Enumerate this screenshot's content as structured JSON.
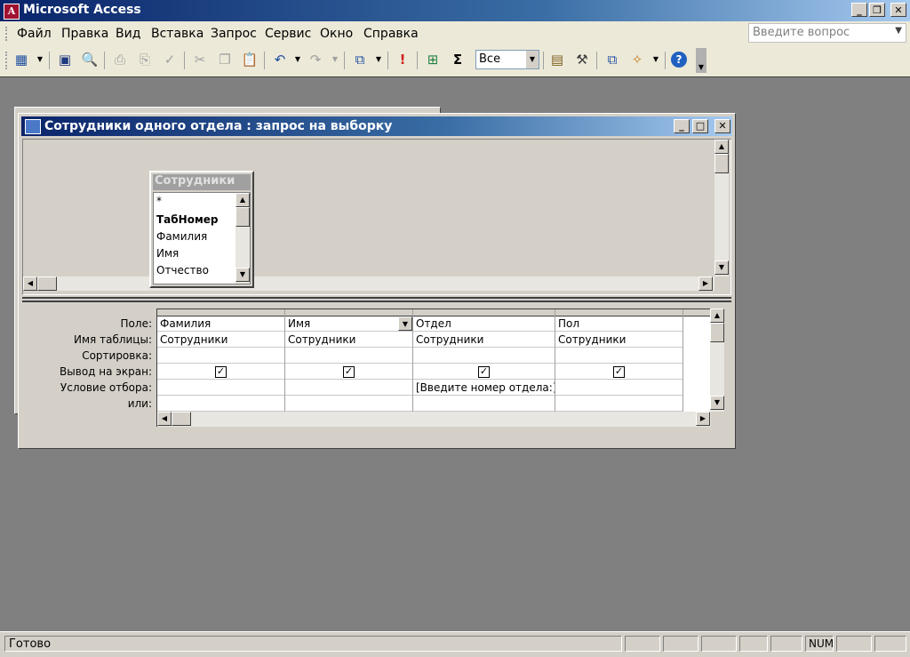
{
  "app": {
    "title": "Microsoft Access"
  },
  "menu": [
    {
      "label": "Файл"
    },
    {
      "label": "Правка"
    },
    {
      "label": "Вид"
    },
    {
      "label": "Вставка"
    },
    {
      "label": "Запрос"
    },
    {
      "label": "Сервис"
    },
    {
      "label": "Окно"
    },
    {
      "label": "Справка"
    }
  ],
  "help": {
    "placeholder": "Введите вопрос"
  },
  "toolbar": {
    "top_values": "Все"
  },
  "query_window": {
    "title": "Сотрудники одного отдела : запрос на выборку",
    "table": {
      "name": "Сотрудники",
      "fields": [
        "*",
        "ТабНомер",
        "Фамилия",
        "Имя",
        "Отчество"
      ]
    },
    "row_labels": [
      "Поле:",
      "Имя таблицы:",
      "Сортировка:",
      "Вывод на экран:",
      "Условие отбора:",
      "или:"
    ],
    "columns": [
      {
        "field": "Фамилия",
        "table": "Сотрудники",
        "sort": "",
        "show": true,
        "criteria": "",
        "or": ""
      },
      {
        "field": "Имя",
        "table": "Сотрудники",
        "sort": "",
        "show": true,
        "criteria": "",
        "or": ""
      },
      {
        "field": "Отдел",
        "table": "Сотрудники",
        "sort": "",
        "show": true,
        "criteria": "[Введите номер отдела:]",
        "or": ""
      },
      {
        "field": "Пол",
        "table": "Сотрудники",
        "sort": "",
        "show": true,
        "criteria": "",
        "or": ""
      }
    ]
  },
  "status": {
    "text": "Готово",
    "num": "NUM"
  }
}
